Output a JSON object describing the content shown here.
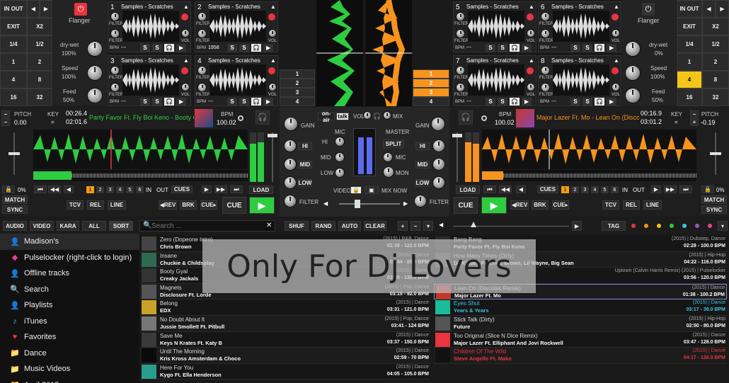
{
  "left_grid": {
    "in_out": "IN OUT",
    "exit": "EXIT",
    "x2": "X2",
    "f14": "1/4",
    "f12": "1/2",
    "n1": "1",
    "n2": "2",
    "n4": "4",
    "n8": "8",
    "n16": "16",
    "n32": "32"
  },
  "right_grid": {
    "in_out": "IN OUT",
    "exit": "EXIT",
    "x2": "X2",
    "f14": "1/4",
    "f12": "1/2",
    "n1": "1",
    "n2": "2",
    "n4": "4",
    "n8": "8",
    "n16": "16",
    "n32": "32"
  },
  "fx_left": {
    "name": "Flanger",
    "drywet_label": "dry-wet",
    "drywet": "100%",
    "speed_label": "Speed",
    "speed": "100%",
    "feed_label": "Feed",
    "feed": "50%"
  },
  "fx_right": {
    "name": "Flanger",
    "drywet_label": "dry-wet",
    "drywet": "0%",
    "speed_label": "Speed",
    "speed": "100%",
    "feed_label": "Feed",
    "feed": "50%"
  },
  "sampler_slots": [
    {
      "n": "1",
      "title": "Samples - Scratches",
      "bpm": "---"
    },
    {
      "n": "2",
      "title": "Samples - Scratches",
      "bpm": "1958"
    },
    {
      "n": "3",
      "title": "Samples - Scratches",
      "bpm": "---"
    },
    {
      "n": "4",
      "title": "Samples - Scratches",
      "bpm": "---"
    },
    {
      "n": "5",
      "title": "Samples - Scratches",
      "bpm": "---"
    },
    {
      "n": "6",
      "title": "Samples - Scratches",
      "bpm": "---"
    },
    {
      "n": "7",
      "title": "Samples - Scratches",
      "bpm": "---"
    },
    {
      "n": "8",
      "title": "Samples - Scratches",
      "bpm": "---"
    }
  ],
  "sampler_labels": {
    "filter": "FILTER",
    "vol": "VOL",
    "bpm": "BPM",
    "s": "S"
  },
  "center_nums": [
    "1",
    "2",
    "3",
    "4"
  ],
  "deck_left": {
    "pitch_label": "PITCH",
    "pitch": "0.00",
    "key_label": "KEY",
    "elapsed": "00:26.4",
    "remain": "02:01.6",
    "title": "Party Favor Ft. Fly Boi Keno - Booty C",
    "bpm_label": "BPM",
    "bpm": "100.02"
  },
  "deck_right": {
    "pitch_label": "PITCH",
    "pitch": "-0.19",
    "key_label": "KEY",
    "elapsed": "00:16.9",
    "remain": "03:01.2",
    "title": "Major Lazer Ft. Mo - Lean On (Discote",
    "bpm_label": "BPM",
    "bpm": "100.02"
  },
  "deck_btns": {
    "match": "MATCH",
    "sync": "SYNC",
    "pct": "0%",
    "load": "LOAD",
    "cues": "CUES",
    "in": "IN",
    "out": "OUT",
    "tcv": "TCV",
    "rel": "REL",
    "line": "LINE",
    "rev": "◀REV",
    "brk": "BRK",
    "cue": "CUE",
    "cue_arrow": "CUE▸",
    "play": "▶"
  },
  "cue_nums": [
    "1",
    "2",
    "3",
    "4",
    "5",
    "6"
  ],
  "mixer": {
    "gain": "GAIN",
    "hi": "HI",
    "mid": "MID",
    "low": "LOW",
    "filter": "FILTER",
    "onair": "on-air",
    "talk": "talk",
    "vol": "VOL",
    "mix": "MIX",
    "mic": "MIC",
    "master": "MASTER",
    "split": "SPLIT",
    "mon": "MON",
    "video": "VIDEO",
    "mixnow": "MIX NOW"
  },
  "browser_bar": {
    "audio": "AUDIO",
    "video": "VIDEO",
    "kara": "KARA",
    "all": "ALL",
    "sort": "SORT",
    "search_placeholder": "Search ...",
    "shuf": "SHUF",
    "rand": "RAND",
    "auto": "AUTO",
    "clear": "CLEAR",
    "tag": "TAG"
  },
  "sidebar": [
    {
      "icon": "user-icon",
      "label": "Madison's"
    },
    {
      "icon": "pulselocker-icon",
      "label": "Pulselocker (right-click to login)"
    },
    {
      "icon": "user-icon",
      "label": "Offline tracks"
    },
    {
      "icon": "search-icon",
      "label": "Search"
    },
    {
      "icon": "user-icon",
      "label": "Playlists"
    },
    {
      "icon": "itunes-icon",
      "label": "iTunes"
    },
    {
      "icon": "heart-icon",
      "label": "Favorites"
    },
    {
      "icon": "folder-icon",
      "label": "Dance"
    },
    {
      "icon": "folder-icon",
      "label": "Music Videos"
    },
    {
      "icon": "folder-icon",
      "label": "April 2015"
    }
  ],
  "tracks_left": [
    {
      "title": "Zero (Dopeone Intro)",
      "artist": "Chris Brown",
      "meta": "(2015) | R&B, Dance",
      "bpm": "01:39 - 122.0 BPM"
    },
    {
      "title": "Insane",
      "artist": "Chuckie & Childsplay",
      "meta": "(2015) | Dance",
      "bpm": "02:44 - 65.0 BPM"
    },
    {
      "title": "Booty Gyal",
      "artist": "Creaky Jackals",
      "meta": "(2015) | Dance",
      "bpm": "03:09 - 130.0 BPM"
    },
    {
      "title": "Magnets",
      "artist": "Disclosure Ft. Lorde",
      "meta": "(2015) | Pop, Dance",
      "bpm": "03:15 - 92.0 BPM"
    },
    {
      "title": "Belong",
      "artist": "EDX",
      "meta": "(2015) | Dance",
      "bpm": "03:31 - 121.0 BPM"
    },
    {
      "title": "No Doubt About It",
      "artist": "Jussie Smollett Ft. Pitbull",
      "meta": "(2015) | Pop, Dance",
      "bpm": "03:41 - 124 BPM"
    },
    {
      "title": "Save Me",
      "artist": "Keys N Krates Ft. Katy B",
      "meta": "(2015) | Dance",
      "bpm": "03:37 - 150.0 BPM"
    },
    {
      "title": "Until The Morning",
      "artist": "Kris Kross Amsterdam & Choco",
      "meta": "(2015) | Dance",
      "bpm": "02:59 - 70 BPM"
    },
    {
      "title": "Here For You",
      "artist": "Kygo Ft. Ella Henderson",
      "meta": "(2015) | Dance",
      "bpm": "04:05 - 105.0 BPM"
    }
  ],
  "tracks_right": [
    {
      "title": "Bang Bang",
      "artist": "Party Favor Ft. Fly Boi Keno",
      "meta": "(2015) | Dubstep, Dance",
      "bpm": "02:28 - 100.0 BPM"
    },
    {
      "title": "How Many Times (Dirty)",
      "artist": "DJ Khaled Ft. Chris Brown, Lil Wayne, Big Sean",
      "meta": "(2015) | Hip-Hop",
      "bpm": "04:22 - 116.0 BPM"
    },
    {
      "title": "",
      "artist": "",
      "meta": "Uptown (Calvin Harris Remix) (2015) | Pulselocker",
      "bpm": "03:56 - 120.0 BPM"
    },
    {
      "title": "Lean On (Discotek Remix)",
      "artist": "Major Lazer Ft. Mo",
      "meta": "(2015) | Dance",
      "bpm": "01:38 - 100.2 BPM"
    },
    {
      "title": "Eyes Shut",
      "artist": "Years & Years",
      "meta": "(2015) | Dance",
      "bpm": "03:17 - 38.0 BPM"
    },
    {
      "title": "Stick Talk (Dirty)",
      "artist": "Future",
      "meta": "(2015) | Hip-Hop",
      "bpm": "02:50 - 80.0 BPM"
    },
    {
      "title": "Too Original (Slice N Dice Remix)",
      "artist": "Major Lazer Ft. Elliphant And Jovi Rockwell",
      "meta": "(2015) | Dance",
      "bpm": "03:47 - 128.0 BPM"
    },
    {
      "title": "Children Of The Wild",
      "artist": "Steve Angello Ft. Mako",
      "meta": "(2015) | Dance",
      "bpm": "04:17 - 128.0 BPM"
    }
  ],
  "watermark": "Only For Dj Lovers",
  "colors": {
    "green": "#2ecc40",
    "orange": "#f7931e",
    "yellow": "#f5c518",
    "cyan": "#39c6e6",
    "red": "#e8353f"
  }
}
